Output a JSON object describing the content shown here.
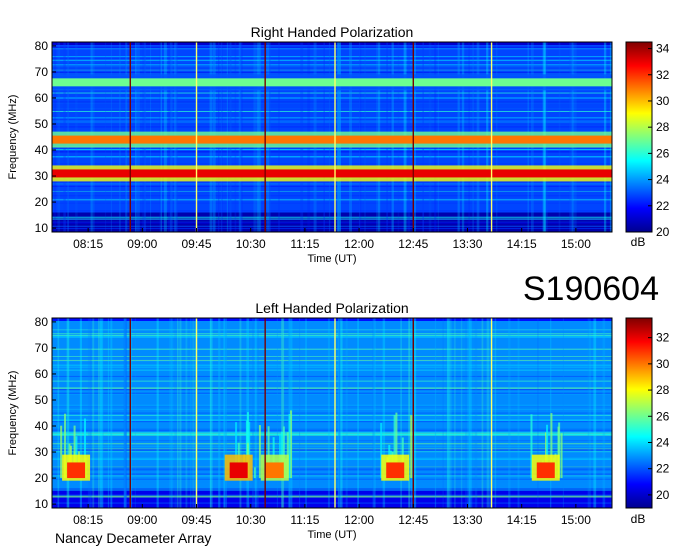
{
  "code": "S190604",
  "footer": "Nancay Decameter Array",
  "colors": {
    "cmap": [
      "#00008f",
      "#0000ff",
      "#007fff",
      "#00ffff",
      "#7fff7f",
      "#ffff00",
      "#ff7f00",
      "#ff0000",
      "#7f0000"
    ],
    "vline_dark": "#7a0000",
    "vline_light": "#ffff66"
  },
  "chart_data": [
    {
      "type": "heatmap",
      "title": "Right Handed Polarization",
      "xlabel": "Time (UT)",
      "ylabel": "Frequency (MHz)",
      "x_ticks": [
        "08:15",
        "09:00",
        "09:45",
        "10:30",
        "11:15",
        "12:00",
        "12:45",
        "13:30",
        "14:15",
        "15:00"
      ],
      "y_ticks": [
        10,
        20,
        30,
        40,
        50,
        60,
        70,
        80
      ],
      "xlim": [
        "07:45",
        "15:30"
      ],
      "ylim": [
        10,
        80
      ],
      "colorbar": {
        "label": "dB",
        "ticks": [
          20,
          22,
          24,
          26,
          28,
          30,
          32,
          34
        ],
        "range": [
          20,
          34.5
        ]
      },
      "features": [
        {
          "type": "band",
          "freq_mhz": 31,
          "value_db": 33
        },
        {
          "type": "band",
          "freq_mhz": 44,
          "value_db": 31
        },
        {
          "type": "band",
          "freq_mhz": 66,
          "value_db": 27
        }
      ],
      "vertical_markers": [
        "08:50",
        "09:45",
        "10:42",
        "11:40",
        "12:45",
        "13:50"
      ]
    },
    {
      "type": "heatmap",
      "title": "Left Handed Polarization",
      "xlabel": "Time (UT)",
      "ylabel": "Frequency (MHz)",
      "x_ticks": [
        "08:15",
        "09:00",
        "09:45",
        "10:30",
        "11:15",
        "12:00",
        "12:45",
        "13:30",
        "14:15",
        "15:00"
      ],
      "y_ticks": [
        10,
        20,
        30,
        40,
        50,
        60,
        70,
        80
      ],
      "xlim": [
        "07:45",
        "15:30"
      ],
      "ylim": [
        10,
        80
      ],
      "colorbar": {
        "label": "dB",
        "ticks": [
          20,
          22,
          24,
          26,
          28,
          30,
          32
        ],
        "range": [
          19,
          33.5
        ]
      },
      "features": [
        {
          "type": "burst",
          "time": "08:05",
          "value_db": 31
        },
        {
          "type": "burst",
          "time": "10:20",
          "value_db": 32
        },
        {
          "type": "burst",
          "time": "10:50",
          "value_db": 30
        },
        {
          "type": "burst",
          "time": "12:30",
          "value_db": 31
        },
        {
          "type": "burst",
          "time": "14:35",
          "value_db": 31
        }
      ],
      "vertical_markers": [
        "08:50",
        "09:45",
        "10:42",
        "11:40",
        "12:45",
        "13:50"
      ]
    }
  ]
}
